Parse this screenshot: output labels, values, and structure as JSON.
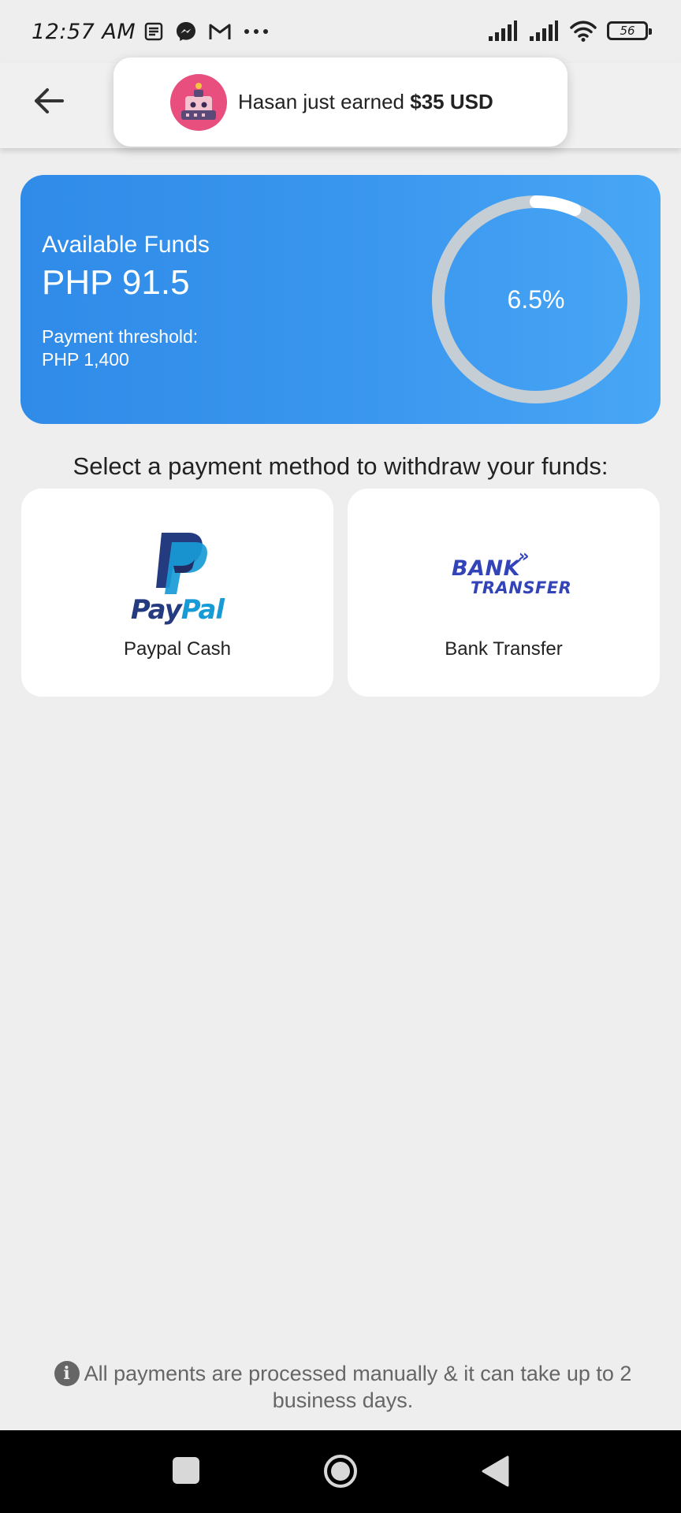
{
  "status_bar": {
    "time": "12:57 AM",
    "battery": "56",
    "icons": [
      "notes-icon",
      "messenger-icon",
      "gmail-icon",
      "more-dots-icon",
      "signal-icon",
      "signal-icon",
      "wifi-icon",
      "battery-icon"
    ]
  },
  "toast": {
    "text": "Hasan just earned ",
    "amount": "$35 USD",
    "avatar": "robot-avatar-icon"
  },
  "funds": {
    "label": "Available Funds",
    "value": "PHP 91.5",
    "threshold_label": "Payment threshold:",
    "threshold_value": "PHP 1,400",
    "progress_text": "6.5%",
    "progress_fraction": 0.065
  },
  "heading": "Select a payment method to withdraw your funds:",
  "methods": [
    {
      "label": "Paypal Cash",
      "logo_pay": "Pay",
      "logo_pal": "Pal"
    },
    {
      "label": "Bank Transfer",
      "logo_line1": "BANK",
      "logo_arrows": "»",
      "logo_line2": "TRANSFER"
    }
  ],
  "footer": {
    "icon": "info-icon",
    "glyph": "i",
    "text": "All payments are processed manually & it can take up to 2 business days."
  },
  "colors": {
    "card_start": "#2f8be8",
    "card_end": "#48a6f6",
    "ring_track": "#c5ced4",
    "ring_progress": "#ffffff",
    "paypal_dark": "#253b80",
    "paypal_light": "#179bd7",
    "bank_blue": "#3343b8"
  }
}
